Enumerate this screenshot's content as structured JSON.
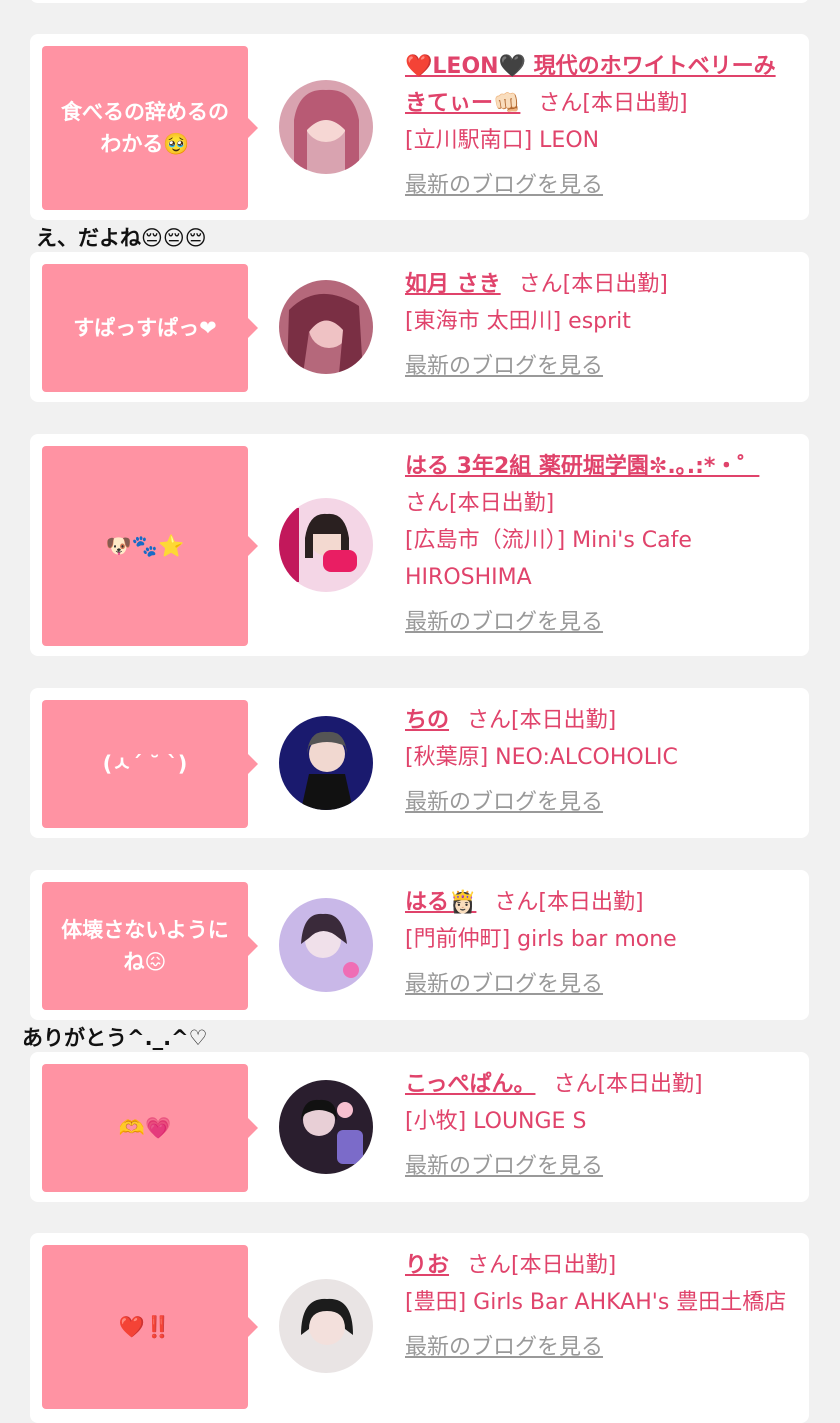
{
  "colors": {
    "accent": "#e0436b",
    "bubble": "#ff93a3",
    "link_gray": "#999999",
    "background": "#f1f1f1"
  },
  "blog_link_label": "最新のブログを見る",
  "san_label": "さん[本日出勤]",
  "entries": [
    {
      "bubble": "食べるの辞めるの\nわかる🥹",
      "name": "❤️LEON🖤 現代のホワイトベリーみきてぃー👊🏻",
      "shop": "[立川駅南口] LEON"
    },
    {
      "bubble": "すぱっすぱっ❤",
      "name": "如月 さき",
      "shop": "[東海市 太田川] esprit"
    },
    {
      "bubble": "🐶🐾⭐",
      "name": "はる 3年2組 薬研堀学園✼.｡.:*・゜",
      "shop": "[広島市（流川）] Mini's Cafe HIROSHIMA"
    },
    {
      "bubble": "(ㅅ´ ˘ `)",
      "name": "ちの",
      "shop": "[秋葉原] NEO:ALCOHOLIC"
    },
    {
      "bubble": "体壊さないように\nね😖",
      "name": "はる👸🏻",
      "shop": "[門前仲町] girls bar mone"
    },
    {
      "bubble": "🫶💗",
      "name": "こっぺぱん。",
      "shop": "[小牧] LOUNGE S"
    },
    {
      "bubble": "❤️‼️",
      "name": "りお",
      "shop": "[豊田] Girls Bar AHKAH's 豊田土橋店"
    }
  ],
  "comments": {
    "after_first": "え、だよね😔😔😔",
    "after_fifth": "ありがとう^._.^♡"
  }
}
